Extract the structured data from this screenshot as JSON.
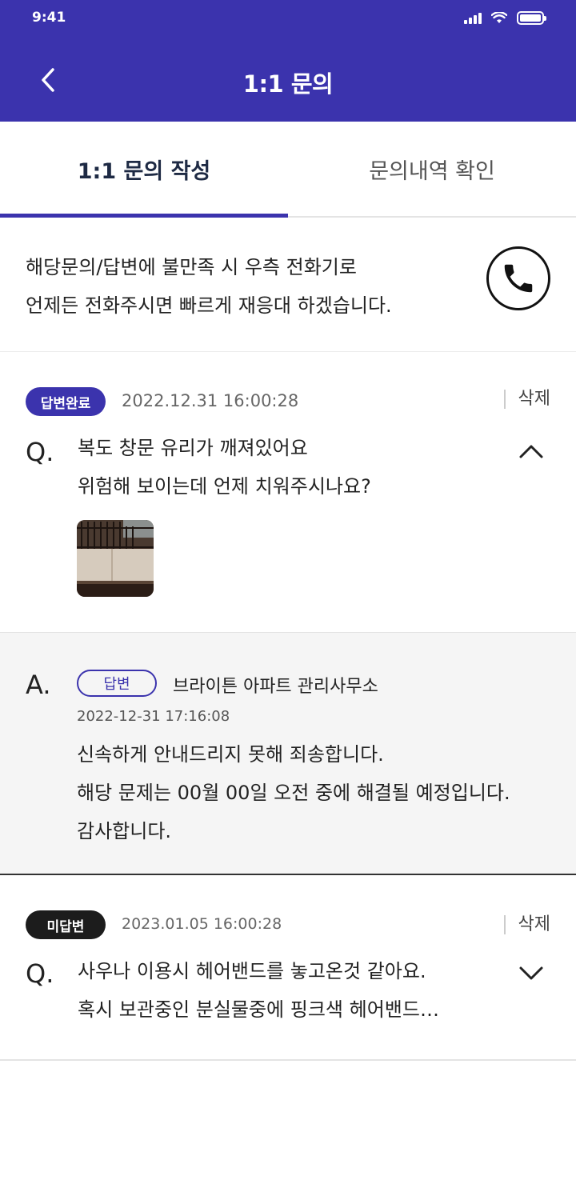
{
  "status_bar": {
    "time": "9:41",
    "icons": [
      "signal-icon",
      "wifi-icon",
      "battery-icon"
    ]
  },
  "header": {
    "title": "1:1 문의",
    "back_icon": "chevron-left-icon"
  },
  "tabs": [
    {
      "label": "1:1 문의 작성",
      "active": true
    },
    {
      "label": "문의내역 확인",
      "active": false
    }
  ],
  "notice": {
    "lines": [
      "해당문의/답변에 불만족 시 우측 전화기로",
      "언제든 전화주시면 빠르게 재응대 하겠습니다."
    ],
    "icon": "phone-icon"
  },
  "inquiries": [
    {
      "status": "답변완료",
      "datetime": "2022.12.31  16:00:28",
      "delete_label": "삭제",
      "q_label": "Q.",
      "question_lines": [
        "복도 창문 유리가 깨져있어요",
        "위험해 보이는데 언제 치워주시나요?"
      ],
      "expanded": true,
      "has_image": true
    },
    {
      "status": "미답변",
      "datetime": "2023.01.05  16:00:28",
      "delete_label": "삭제",
      "q_label": "Q.",
      "question_lines": [
        "사우나 이용시 헤어밴드를 놓고온것 같아요.",
        "혹시 보관중인 분실물중에 핑크색 헤어밴드…"
      ],
      "expanded": false,
      "has_image": false
    }
  ],
  "answer": {
    "a_label": "A.",
    "tag": "답변",
    "office": "브라이튼 아파트 관리사무소",
    "datetime": "2022-12-31 17:16:08",
    "lines": [
      "신속하게 안내드리지 못해 죄송합니다.",
      "해당 문제는 00월 00일 오전 중에 해결될 예정입니다.",
      "감사합니다."
    ]
  },
  "colors": {
    "brand": "#3b33ad",
    "pending_badge": "#1c1c1c",
    "answer_bg": "#f5f5f5"
  }
}
